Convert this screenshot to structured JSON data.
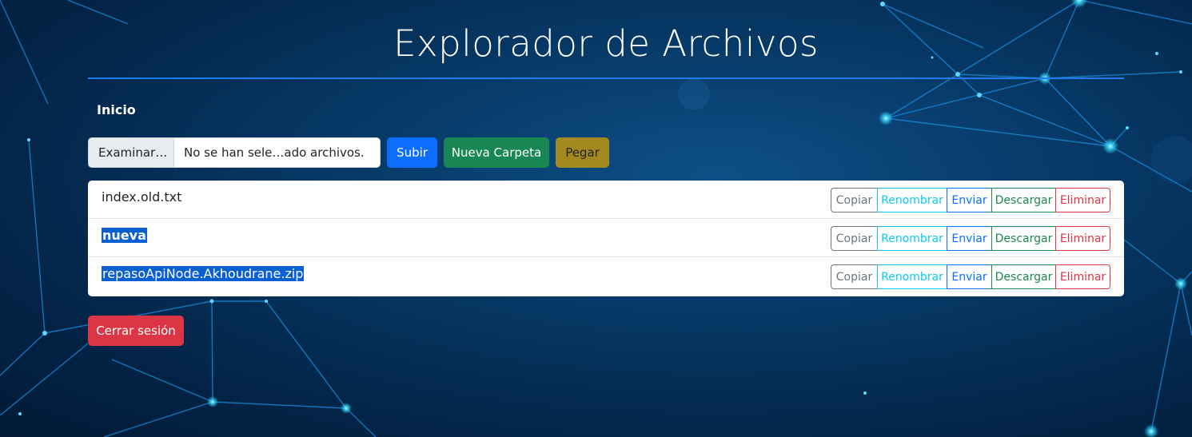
{
  "page": {
    "title": "Explorador de Archivos",
    "breadcrumb": "Inicio"
  },
  "upload": {
    "browse_label": "Examinar…",
    "file_status": "No se han sele…ado archivos.",
    "upload_label": "Subir",
    "new_folder_label": "Nueva Carpeta",
    "paste_label": "Pegar"
  },
  "files": [
    {
      "name": "index.old.txt",
      "selected": false,
      "bold": false
    },
    {
      "name": "nueva",
      "selected": true,
      "bold": true
    },
    {
      "name": "repasoApiNode.Akhoudrane.zip",
      "selected": true,
      "bold": false
    }
  ],
  "actions": {
    "copy": "Copiar",
    "rename": "Renombrar",
    "send": "Enviar",
    "download": "Descargar",
    "delete": "Eliminar"
  },
  "logout_label": "Cerrar sesión",
  "colors": {
    "accent_line": "#1e7be8",
    "primary": "#0d6efd",
    "success": "#198754",
    "warning": "#a3891f",
    "danger": "#dc3545",
    "info": "#0dcaf0",
    "secondary": "#6c757d",
    "selection": "#0a5fd1"
  }
}
